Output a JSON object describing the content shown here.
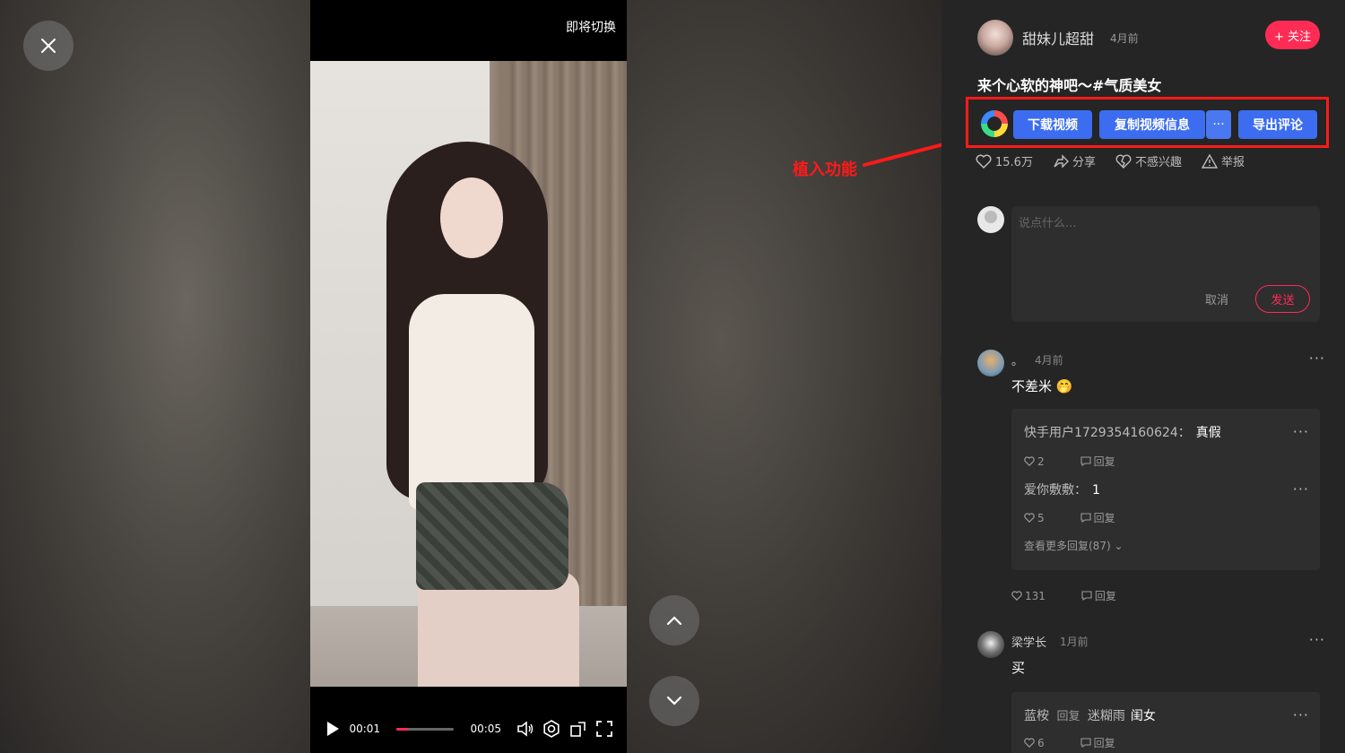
{
  "player": {
    "switch_tip": "即将切换",
    "current_time": "00:01",
    "total_time": "00:05",
    "progress": 0.2
  },
  "annotation": {
    "label": "植入功能",
    "color": "#ff1a1a"
  },
  "author": {
    "name": "甜妹儿超甜",
    "time": "4月前",
    "follow_label": "+ 关注"
  },
  "video": {
    "caption": "来个心软的神吧～#气质美女"
  },
  "plugin": {
    "download_label": "下载视频",
    "copy_info_label": "复制视频信息",
    "more_label": "···",
    "export_comments_label": "导出评论"
  },
  "actions": {
    "likes": "15.6万",
    "share": "分享",
    "not_interested": "不感兴趣",
    "report": "举报"
  },
  "comment_box": {
    "placeholder": "说点什么...",
    "cancel_label": "取消",
    "send_label": "发送"
  },
  "comments": [
    {
      "name": "。",
      "time": "4月前",
      "text": "不差米 🤭",
      "replies": [
        {
          "user": "快手用户1729354160624：",
          "text": "真假",
          "likes": "2",
          "reply_label": "回复"
        },
        {
          "user": "爱你敷敷：",
          "text": "1",
          "likes": "5",
          "reply_label": "回复"
        }
      ],
      "more_replies": "查看更多回复(87) ⌄",
      "likes": "131",
      "reply_label": "回复"
    },
    {
      "name": "梁学长",
      "time": "1月前",
      "text": "买",
      "replies": [
        {
          "user": "蓝桉",
          "reply_word": "回复",
          "target": "迷糊雨",
          "text": "闺女",
          "likes": "6",
          "reply_label": "回复"
        }
      ]
    }
  ],
  "colors": {
    "accent": "#fe2c55",
    "plugin_blue": "#3c6df0",
    "panel_bg": "#252525"
  }
}
